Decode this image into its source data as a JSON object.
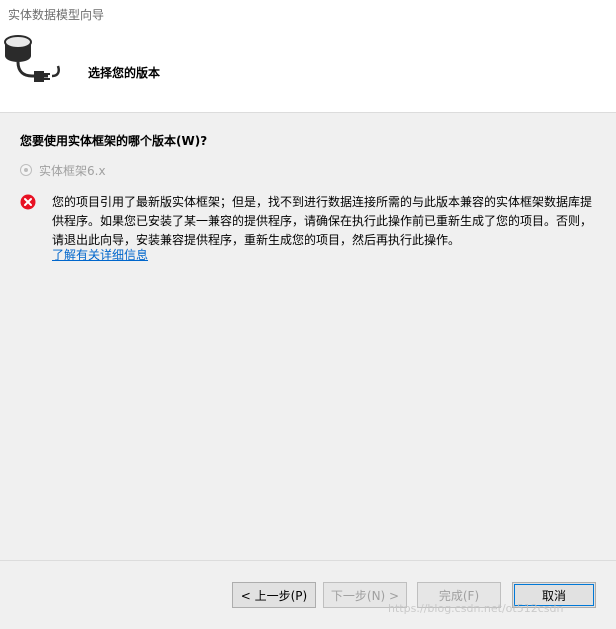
{
  "window": {
    "title": "实体数据模型向导"
  },
  "header": {
    "step_title": "选择您的版本",
    "icon": "database-plug-icon"
  },
  "main": {
    "question": "您要使用实体框架的哪个版本(W)?",
    "version_option": {
      "label": "实体框架6.x",
      "selected": true,
      "enabled": false
    },
    "error": {
      "icon": "error-icon",
      "message": "您的项目引用了最新版实体框架；但是，找不到进行数据连接所需的与此版本兼容的实体框架数据库提供程序。如果您已安装了某一兼容的提供程序，请确保在执行此操作前已重新生成了您的项目。否则，请退出此向导，安装兼容提供程序，重新生成您的项目，然后再执行此操作。",
      "link": "了解有关详细信息"
    }
  },
  "footer": {
    "buttons": {
      "back": "< 上一步(P)",
      "next": "下一步(N) >",
      "finish": "完成(F)",
      "cancel": "取消"
    },
    "watermark": "https://blog.csdn.net/ot512csdn"
  },
  "colors": {
    "error_red": "#e81123",
    "link_blue": "#0066cc",
    "focus_blue": "#0078d7"
  }
}
